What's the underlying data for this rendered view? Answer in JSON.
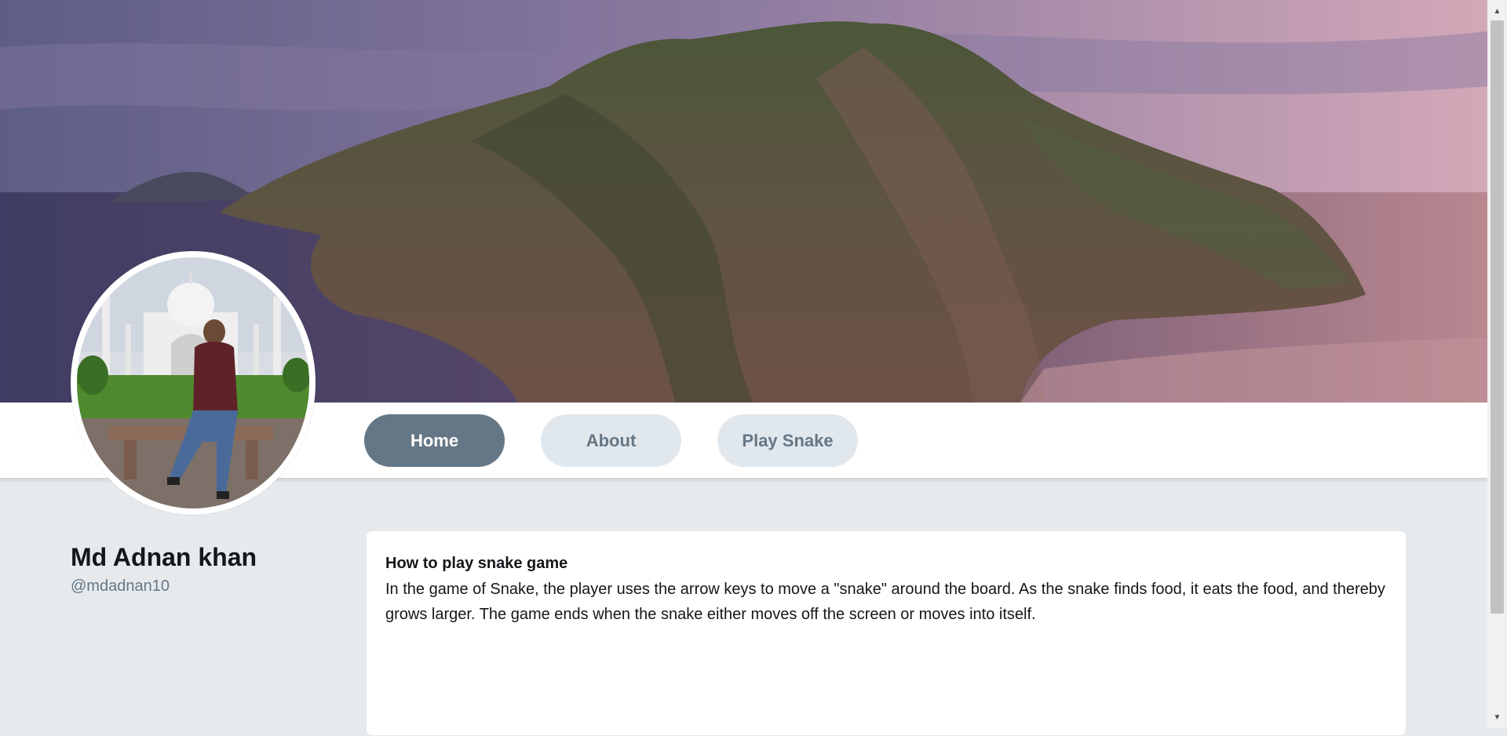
{
  "nav": {
    "home_label": "Home",
    "about_label": "About",
    "snake_label": "Play Snake",
    "active_tab": "Home"
  },
  "profile": {
    "name": "Md Adnan khan",
    "handle": "@mdadnan10"
  },
  "card": {
    "title": "How to play snake game",
    "body": "In the game of Snake, the player uses the arrow keys to move a \"snake\" around the board. As the snake finds food, it eats the food, and thereby grows larger. The game ends when the snake either moves off the screen or moves into itself."
  },
  "images": {
    "cover": "coastal-cliff-landscape",
    "avatar": "person-seated-on-bench-in-front-of-white-domed-monument"
  },
  "colors": {
    "active_button": "#657786",
    "inactive_button": "#e1e8ed",
    "inactive_text": "#657786",
    "page_background": "#e6eaed"
  },
  "icons": {
    "scroll_up": "▲",
    "scroll_down": "▼"
  }
}
